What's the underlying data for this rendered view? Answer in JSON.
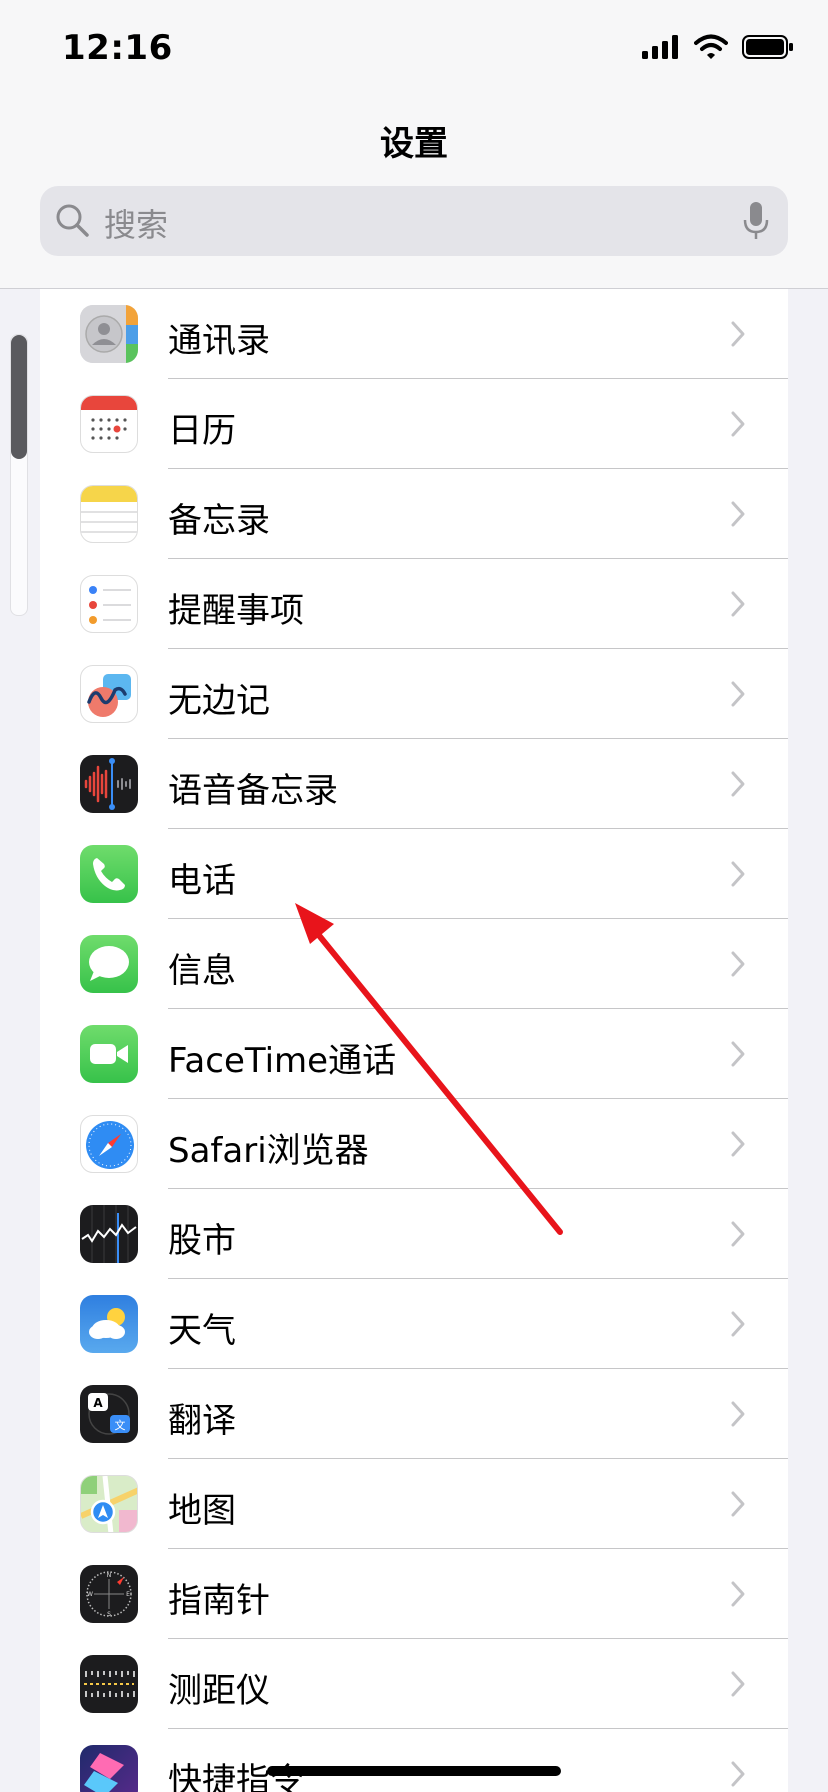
{
  "status_bar": {
    "time": "12:16",
    "icons": [
      "cellular-signal-icon",
      "wifi-icon",
      "battery-icon"
    ]
  },
  "header": {
    "title": "设置",
    "search": {
      "placeholder": "搜索",
      "left_icon": "search-icon",
      "right_icon": "mic-icon"
    }
  },
  "list": {
    "items": [
      {
        "label": "通讯录",
        "icon": "contacts-icon"
      },
      {
        "label": "日历",
        "icon": "calendar-icon"
      },
      {
        "label": "备忘录",
        "icon": "notes-icon"
      },
      {
        "label": "提醒事项",
        "icon": "reminders-icon"
      },
      {
        "label": "无边记",
        "icon": "freeform-icon"
      },
      {
        "label": "语音备忘录",
        "icon": "voice-memos-icon"
      },
      {
        "label": "电话",
        "icon": "phone-icon"
      },
      {
        "label": "信息",
        "icon": "messages-icon"
      },
      {
        "label": "FaceTime通话",
        "icon": "facetime-icon"
      },
      {
        "label": "Safari浏览器",
        "icon": "safari-icon"
      },
      {
        "label": "股市",
        "icon": "stocks-icon"
      },
      {
        "label": "天气",
        "icon": "weather-icon"
      },
      {
        "label": "翻译",
        "icon": "translate-icon"
      },
      {
        "label": "地图",
        "icon": "maps-icon"
      },
      {
        "label": "指南针",
        "icon": "compass-icon"
      },
      {
        "label": "测距仪",
        "icon": "measure-icon"
      },
      {
        "label": "快捷指令",
        "icon": "shortcuts-icon"
      }
    ]
  },
  "annotation": {
    "color": "#e8141b",
    "points_to": "电话"
  },
  "colors": {
    "chevron": "#c4c4c7",
    "separator": "#c6c6c8",
    "background": "#f2f2f7"
  }
}
